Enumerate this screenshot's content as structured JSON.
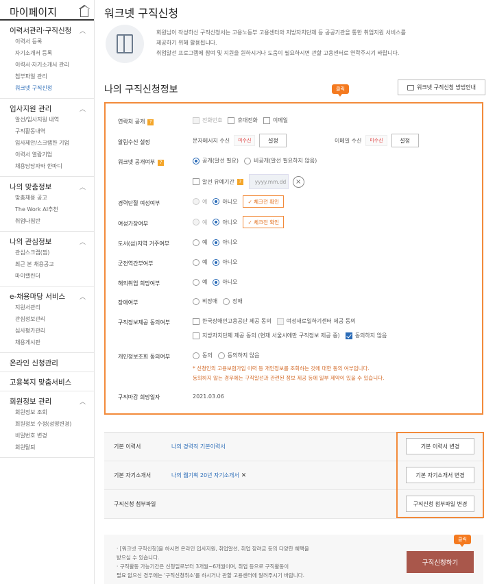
{
  "sidebar": {
    "title": "마이페이지",
    "sections": [
      {
        "title": "이력서관리·구직신청",
        "items": [
          "이력서 등록",
          "자기소개서 등록",
          "이력서·자기소개서 관리",
          "첨부파일 관리",
          "워크넷 구직신청"
        ]
      },
      {
        "title": "입사지원 관리",
        "items": [
          "알선/입사지원 내역",
          "구직활동내역",
          "입사제안/스크랩한 기업",
          "이력서 열람기업",
          "채용담당자와 한마디"
        ]
      },
      {
        "title": "나의 맞춤정보",
        "items": [
          "맞춤채용 공고",
          "The Work AI추천",
          "취업나침반"
        ]
      },
      {
        "title": "나의 관심정보",
        "items": [
          "관심스크랩(찜)",
          "최근 본 채용공고",
          "마이캘린더"
        ]
      },
      {
        "title": "e-채용마당 서비스",
        "items": [
          "지원서관리",
          "관심정보관리",
          "심사평가관리",
          "채용게시판"
        ]
      },
      {
        "title": "온라인 신청관리",
        "items": []
      },
      {
        "title": "고용복지 맞춤서비스",
        "items": []
      },
      {
        "title": "회원정보 관리",
        "items": [
          "회원정보 조회",
          "회원정보 수정(성명변경)",
          "비밀번호 변경",
          "회원탈퇴"
        ]
      }
    ]
  },
  "header": {
    "title": "워크넷 구직신청"
  },
  "intro": {
    "line1": "회원님이 작성하신 구직신청서는 고용노동부 고용센터와 지방자치단체 등 공공기관을 통한 취업지원 서비스를",
    "line2": "제공하기 위해 활용됩니다.",
    "line3": "취업알선 프로그램에 참여 및 지원을 원하시거나 도움이 필요하시면 관할 고용센터로 연락주시기 바랍니다."
  },
  "section": {
    "title": "나의 구직신청정보",
    "guide_button": "워크넷 구직신청 방법안내",
    "click_label": "클릭"
  },
  "form": {
    "contact": {
      "label": "연락처 공개",
      "opts": [
        "전화번호",
        "휴대전화",
        "이메일"
      ]
    },
    "alarm": {
      "label": "알림수신 설정",
      "sms": "문자메시지 수신",
      "email": "이메일 수신",
      "status": "미수신",
      "btn": "설정"
    },
    "open": {
      "label": "워크넷 공개여부",
      "opt1": "공개(알선 필요)",
      "opt2": "비공개(알선 필요하지 않음)",
      "defer": "알선 유예기간",
      "date_ph": "yyyy.mm.dd"
    },
    "career_break": {
      "label": "경력단절 여성여부",
      "yes": "예",
      "no": "아니오",
      "check": "체크전 확인"
    },
    "female_head": {
      "label": "여성가장여부",
      "yes": "예",
      "no": "아니오",
      "check": "체크전 확인"
    },
    "island": {
      "label": "도서(섬)지역 거주여부",
      "yes": "예",
      "no": "아니오"
    },
    "military": {
      "label": "군전역간부여부",
      "yes": "예",
      "no": "아니오"
    },
    "overseas": {
      "label": "해외취업 희망여부",
      "yes": "예",
      "no": "아니오"
    },
    "disability": {
      "label": "장애여부",
      "opt1": "비장애",
      "opt2": "장애"
    },
    "consent": {
      "label": "구직정보제공 동의여부",
      "opt1": "한국장애인고용공단 제공 동의",
      "opt2": "여성새로일하기센터 제공 동의",
      "opt3": "지방자치단체 제공 동의 (현재 서울시에만 구직정보 제공 중)",
      "opt4": "동의하지 않음"
    },
    "personal": {
      "label": "개인정보조회 동의여부",
      "opt1": "동의",
      "opt2": "동의하지 않음",
      "notice1": "* 신청인의 고용보험가입 이력 등 개인정보를 조회하는 것에 대한 동의 여부입니다.",
      "notice2": "동의하지 않는 경우에는 구직알선과 관련된 정보 제공 등에 일부 제약이 있을 수 있습니다."
    },
    "deadline": {
      "label": "구직마감 희망일자",
      "value": "2021.03.06"
    }
  },
  "files": {
    "resume": {
      "label": "기본 이력서",
      "value": "나의 경력직 기본이력서",
      "btn": "기본 이력서 변경"
    },
    "intro": {
      "label": "기본 자기소개서",
      "value": "나의 웹기획 20년 자기소개서",
      "btn": "기본 자기소개서 변경"
    },
    "attach": {
      "label": "구직신청 첨부파일",
      "btn": "구직신청 첨부파일 변경"
    }
  },
  "bottom": {
    "b1": "· [워크넷 구직신청]을 하시면 온라인 입사지원, 취업알선, 취업 장려금 등의 다양한 혜택을",
    "b2": "  받으실 수 있습니다.",
    "b3": "· 구직활동 가능기간은 신청일로부터 3개월~6개월이며, 취업 등으로 구직활동이",
    "b4": "  필요 없으신 경우에는 '구직신청취소'를 하시거나 관할 고용센터에 알려주시기 바랍니다.",
    "apply": "구직신청하기",
    "click_label": "클릭"
  }
}
